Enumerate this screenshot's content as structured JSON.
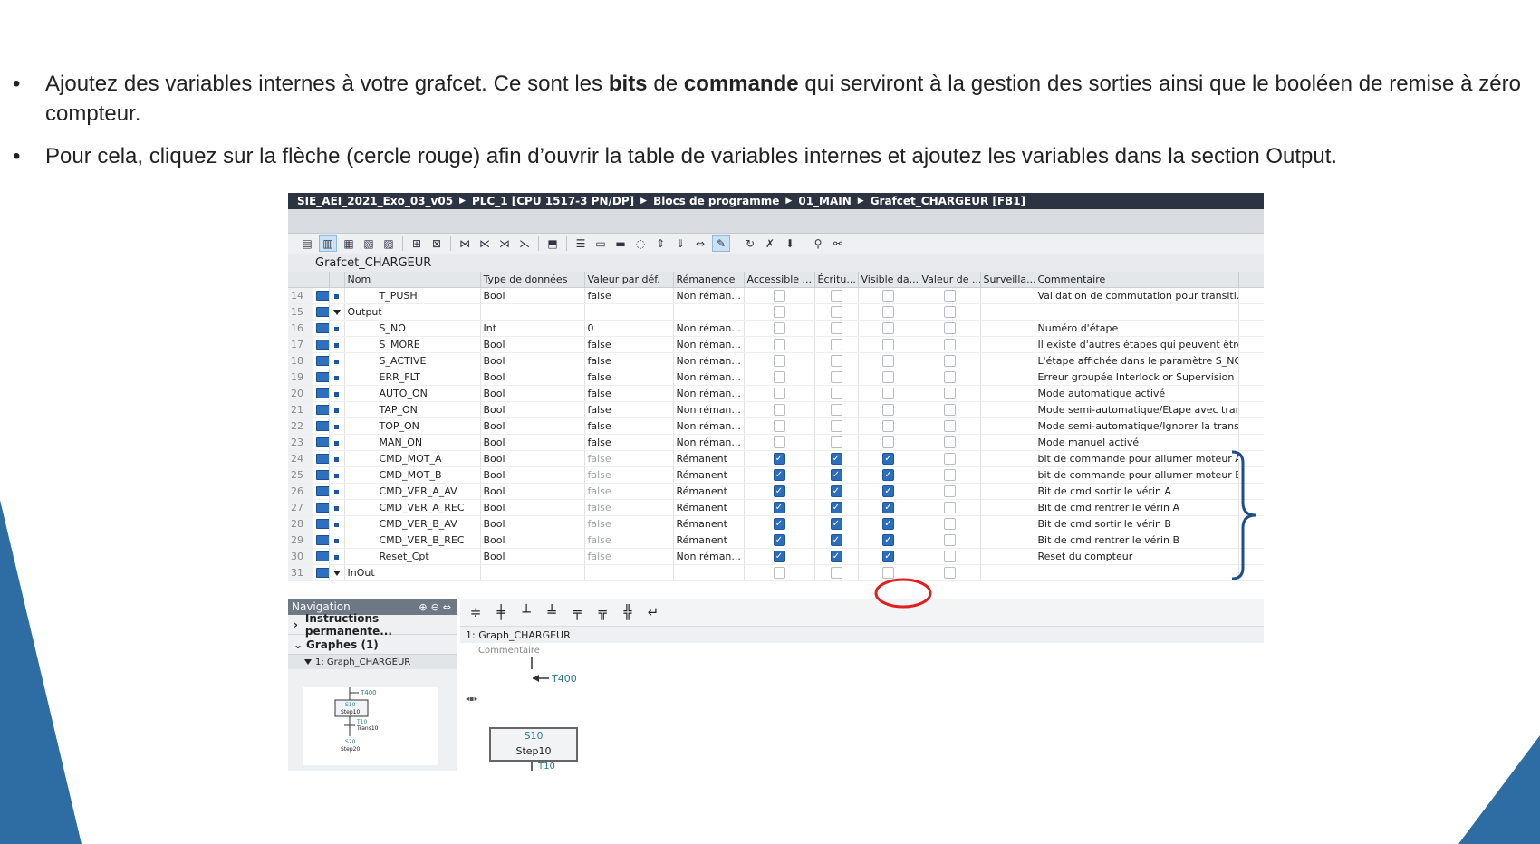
{
  "bullets": [
    {
      "parts": [
        "Ajoutez des variables internes à votre grafcet. Ce sont les ",
        "bits",
        " de ",
        "commande",
        " qui serviront à la gestion des sorties ainsi que le booléen de remise à zéro compteur."
      ]
    },
    {
      "parts": [
        "Pour cela, cliquez sur la flèche (cercle rouge) afin d’ouvrir la table de variables internes et ajoutez les variables dans la section Output."
      ]
    }
  ],
  "tia": {
    "breadcrumb": [
      "SIE_AEI_2021_Exo_03_v05",
      "PLC_1 [CPU 1517-3 PN/DP]",
      "Blocs de programme",
      "01_MAIN",
      "Grafcet_CHARGEUR [FB1]"
    ],
    "block_title": "Grafcet_CHARGEUR",
    "columns": [
      "Nom",
      "Type de données",
      "Valeur par déf.",
      "Rémanence",
      "Accessible ...",
      "Écritu...",
      "Visible da...",
      "Valeur de ...",
      "Surveilla...",
      "Commentaire"
    ],
    "rows": [
      {
        "n": "14",
        "name": "T_PUSH",
        "type": "Bool",
        "def": "false",
        "rem": "Non réman...",
        "acc": false,
        "ecr": false,
        "vis": false,
        "comment": "Validation de commutation pour transiti..."
      },
      {
        "n": "15",
        "name": "Output",
        "section": true
      },
      {
        "n": "16",
        "name": "S_NO",
        "type": "Int",
        "def": "0",
        "rem": "Non réman...",
        "acc": false,
        "ecr": false,
        "vis": false,
        "comment": "Numéro d'étape"
      },
      {
        "n": "17",
        "name": "S_MORE",
        "type": "Bool",
        "def": "false",
        "rem": "Non réman...",
        "acc": false,
        "ecr": false,
        "vis": false,
        "comment": "Il existe d'autres étapes qui peuvent être"
      },
      {
        "n": "18",
        "name": "S_ACTIVE",
        "type": "Bool",
        "def": "false",
        "rem": "Non réman...",
        "acc": false,
        "ecr": false,
        "vis": false,
        "comment": "L'étape affichée dans le paramètre S_NO."
      },
      {
        "n": "19",
        "name": "ERR_FLT",
        "type": "Bool",
        "def": "false",
        "rem": "Non réman...",
        "acc": false,
        "ecr": false,
        "vis": false,
        "comment": "Erreur groupée Interlock or Supervision"
      },
      {
        "n": "20",
        "name": "AUTO_ON",
        "type": "Bool",
        "def": "false",
        "rem": "Non réman...",
        "acc": false,
        "ecr": false,
        "vis": false,
        "comment": "Mode automatique activé"
      },
      {
        "n": "21",
        "name": "TAP_ON",
        "type": "Bool",
        "def": "false",
        "rem": "Non réman...",
        "acc": false,
        "ecr": false,
        "vis": false,
        "comment": "Mode semi-automatique/Etape avec tran"
      },
      {
        "n": "22",
        "name": "TOP_ON",
        "type": "Bool",
        "def": "false",
        "rem": "Non réman...",
        "acc": false,
        "ecr": false,
        "vis": false,
        "comment": "Mode semi-automatique/Ignorer la trans."
      },
      {
        "n": "23",
        "name": "MAN_ON",
        "type": "Bool",
        "def": "false",
        "rem": "Non réman...",
        "acc": false,
        "ecr": false,
        "vis": false,
        "comment": "Mode manuel activé"
      },
      {
        "n": "24",
        "name": "CMD_MOT_A",
        "type": "Bool",
        "def": "false",
        "rem": "Rémanent",
        "acc": true,
        "ecr": true,
        "vis": true,
        "dim": true,
        "comment": "bit de commande pour allumer moteur A"
      },
      {
        "n": "25",
        "name": "CMD_MOT_B",
        "type": "Bool",
        "def": "false",
        "rem": "Rémanent",
        "acc": true,
        "ecr": true,
        "vis": true,
        "dim": true,
        "comment": "bit de commande pour allumer moteur B"
      },
      {
        "n": "26",
        "name": "CMD_VER_A_AV",
        "type": "Bool",
        "def": "false",
        "rem": "Rémanent",
        "acc": true,
        "ecr": true,
        "vis": true,
        "dim": true,
        "comment": "Bit de cmd sortir le vérin A"
      },
      {
        "n": "27",
        "name": "CMD_VER_A_REC",
        "type": "Bool",
        "def": "false",
        "rem": "Rémanent",
        "acc": true,
        "ecr": true,
        "vis": true,
        "dim": true,
        "comment": "Bit de cmd rentrer le vérin A"
      },
      {
        "n": "28",
        "name": "CMD_VER_B_AV",
        "type": "Bool",
        "def": "false",
        "rem": "Rémanent",
        "acc": true,
        "ecr": true,
        "vis": true,
        "dim": true,
        "comment": "Bit de cmd sortir le vérin B"
      },
      {
        "n": "29",
        "name": "CMD_VER_B_REC",
        "type": "Bool",
        "def": "false",
        "rem": "Rémanent",
        "acc": true,
        "ecr": true,
        "vis": true,
        "dim": true,
        "comment": "Bit de cmd rentrer le vérin B"
      },
      {
        "n": "30",
        "name": "Reset_Cpt",
        "type": "Bool",
        "def": "false",
        "rem": "Non réman...",
        "acc": true,
        "ecr": true,
        "vis": true,
        "dim": true,
        "comment": "Reset du compteur"
      },
      {
        "n": "31",
        "name": "InOut",
        "section": true
      }
    ],
    "navigation": {
      "title": "Navigation",
      "items": [
        "Instructions permanente...",
        "Graphes (1)"
      ],
      "sub": "1: Graph_CHARGEUR",
      "thumb": {
        "t400": "T400",
        "s10": "S10",
        "step10": "Step10",
        "t10": "T10",
        "trans10": "Trans10",
        "s20": "S20",
        "step20": "Step20"
      }
    },
    "editor": {
      "graph_label": "1:   Graph_CHARGEUR",
      "comment": "Commentaire",
      "transition_top": "T400",
      "step_num": "S10",
      "step_name": "Step10",
      "transition_bottom": "T10"
    }
  },
  "colors": {
    "deco_blue": "#2e6da4",
    "accent_red": "#e02020",
    "brace_blue": "#1f4e8c"
  }
}
